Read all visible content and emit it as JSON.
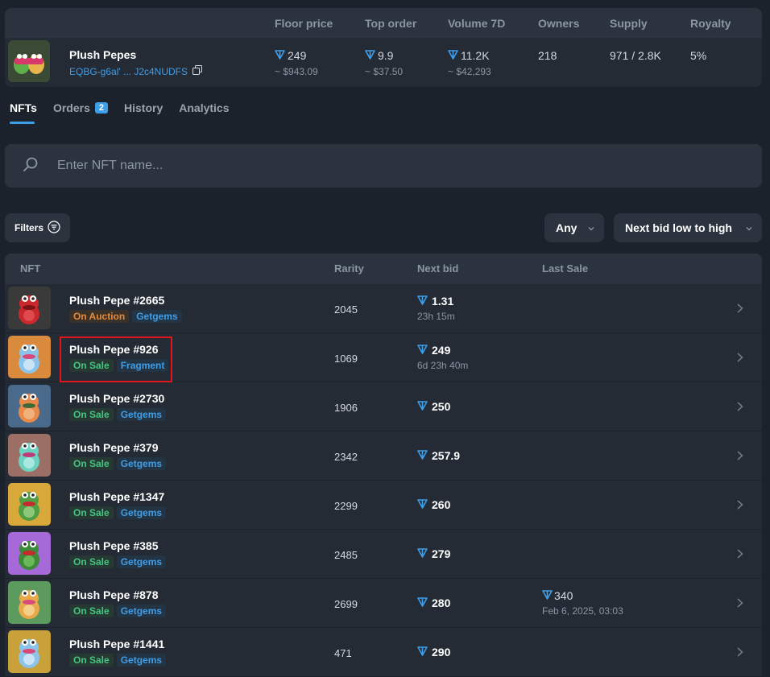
{
  "header": {
    "labels": {
      "floor": "Floor price",
      "top_order": "Top order",
      "volume": "Volume 7D",
      "owners": "Owners",
      "supply": "Supply",
      "royalty": "Royalty"
    },
    "collection_name": "Plush Pepes",
    "address": "EQBG-g6al' ... J2c4NUDFS",
    "floor_value": "249",
    "floor_usd": "~ $943.09",
    "top_order_value": "9.9",
    "top_order_usd": "~ $37.50",
    "volume_value": "11.2K",
    "volume_usd": "~ $42,293",
    "owners_value": "218",
    "supply_value": "971 / 2.8K",
    "royalty_value": "5%"
  },
  "tabs": [
    {
      "label": "NFTs"
    },
    {
      "label": "Orders",
      "badge": "2"
    },
    {
      "label": "History"
    },
    {
      "label": "Analytics"
    }
  ],
  "search": {
    "placeholder": "Enter NFT name..."
  },
  "filters": {
    "label": "Filters"
  },
  "dropdowns": {
    "status": "Any",
    "sort": "Next bid low to high"
  },
  "table": {
    "headers": {
      "nft": "NFT",
      "rarity": "Rarity",
      "next_bid": "Next bid",
      "last_sale": "Last Sale"
    },
    "rows": [
      {
        "name": "Plush Pepe #2665",
        "status": "On Auction",
        "market": "Getgems",
        "rarity": "2045",
        "bid": "1.31",
        "bid_sub": "23h 15m",
        "last_sale": "",
        "last_sale_date": ""
      },
      {
        "name": "Plush Pepe #926",
        "status": "On Sale",
        "market": "Fragment",
        "rarity": "1069",
        "bid": "249",
        "bid_sub": "6d 23h 40m",
        "last_sale": "",
        "last_sale_date": ""
      },
      {
        "name": "Plush Pepe #2730",
        "status": "On Sale",
        "market": "Getgems",
        "rarity": "1906",
        "bid": "250",
        "bid_sub": "",
        "last_sale": "",
        "last_sale_date": ""
      },
      {
        "name": "Plush Pepe #379",
        "status": "On Sale",
        "market": "Getgems",
        "rarity": "2342",
        "bid": "257.9",
        "bid_sub": "",
        "last_sale": "",
        "last_sale_date": ""
      },
      {
        "name": "Plush Pepe #1347",
        "status": "On Sale",
        "market": "Getgems",
        "rarity": "2299",
        "bid": "260",
        "bid_sub": "",
        "last_sale": "",
        "last_sale_date": ""
      },
      {
        "name": "Plush Pepe #385",
        "status": "On Sale",
        "market": "Getgems",
        "rarity": "2485",
        "bid": "279",
        "bid_sub": "",
        "last_sale": "",
        "last_sale_date": ""
      },
      {
        "name": "Plush Pepe #878",
        "status": "On Sale",
        "market": "Getgems",
        "rarity": "2699",
        "bid": "280",
        "bid_sub": "",
        "last_sale": "340",
        "last_sale_date": "Feb 6, 2025, 03:03"
      },
      {
        "name": "Plush Pepe #1441",
        "status": "On Sale",
        "market": "Getgems",
        "rarity": "471",
        "bid": "290",
        "bid_sub": "",
        "last_sale": "",
        "last_sale_date": ""
      }
    ]
  },
  "colors": {
    "accent": "#3e9ee8",
    "sale": "#45c482",
    "auction": "#e58a3b",
    "highlight": "#e0141c"
  }
}
